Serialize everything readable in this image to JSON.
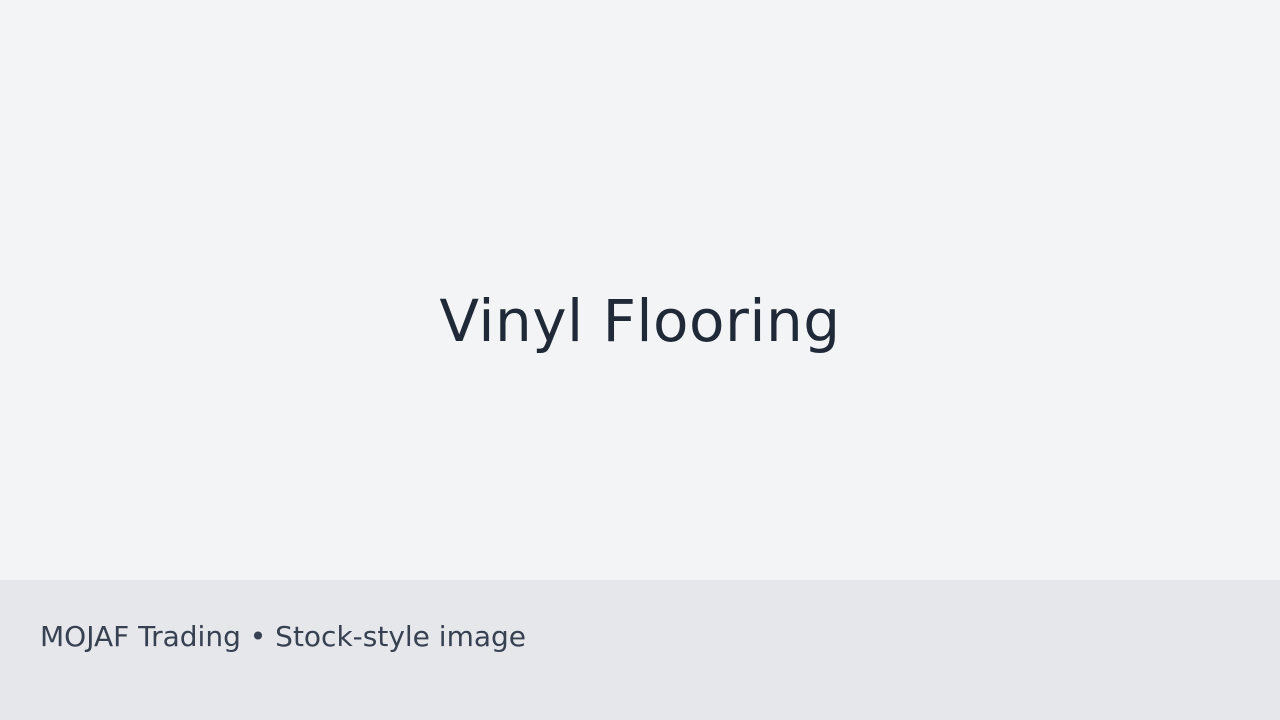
{
  "hero": {
    "title": "Vinyl Flooring"
  },
  "caption": {
    "text": "MOJAF Trading • Stock-style image"
  },
  "colors": {
    "background": "#f3f4f6",
    "caption_bar": "#e5e7eb",
    "title_text": "#1f2937",
    "caption_text": "#374151"
  }
}
